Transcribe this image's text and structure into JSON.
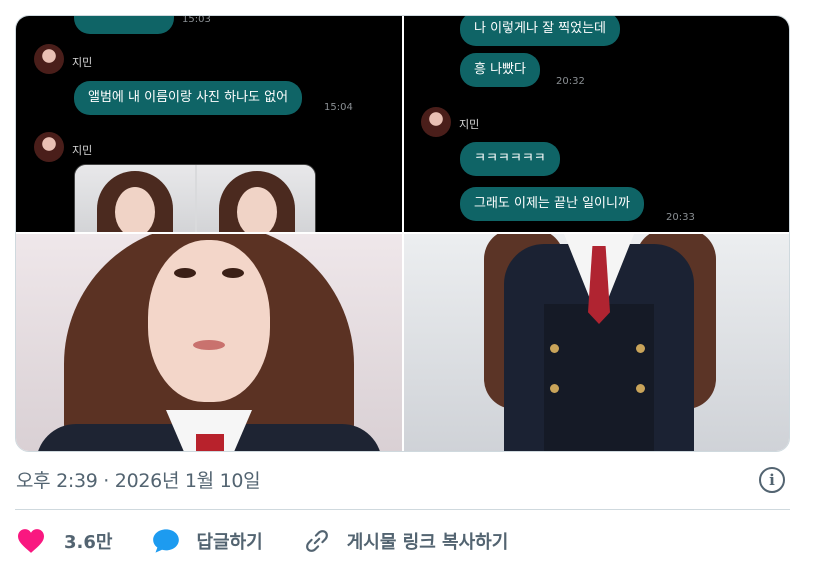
{
  "chat_left": {
    "top_timestamp": "15:03",
    "sender1_name": "지민",
    "message1": "앨범에 내 이름이랑 사진 하나도 없어",
    "message1_time": "15:04",
    "sender2_name": "지민"
  },
  "chat_right": {
    "message1": "나 이렇게나 잘 찍었는데",
    "message2": "흥 나빴다",
    "message2_time": "20:32",
    "sender_name": "지민",
    "message3": "ㅋㅋㅋㅋㅋㅋ",
    "message4": "그래도 이제는 끝난 일이니까",
    "message4_time": "20:33"
  },
  "post": {
    "timestamp": "오후 2:39 · 2026년 1월 10일",
    "info_symbol": "i"
  },
  "actions": {
    "like_count": "3.6만",
    "reply_label": "답글하기",
    "copy_link_label": "게시물 링크 복사하기"
  },
  "colors": {
    "like": "#f91880",
    "reply": "#1d9bf0",
    "chat_bubble": "#0f6466",
    "muted_text": "#536471"
  },
  "icons": {
    "like": "heart-icon",
    "reply": "comment-bubble-icon",
    "copy_link": "link-icon",
    "info": "info-icon"
  }
}
